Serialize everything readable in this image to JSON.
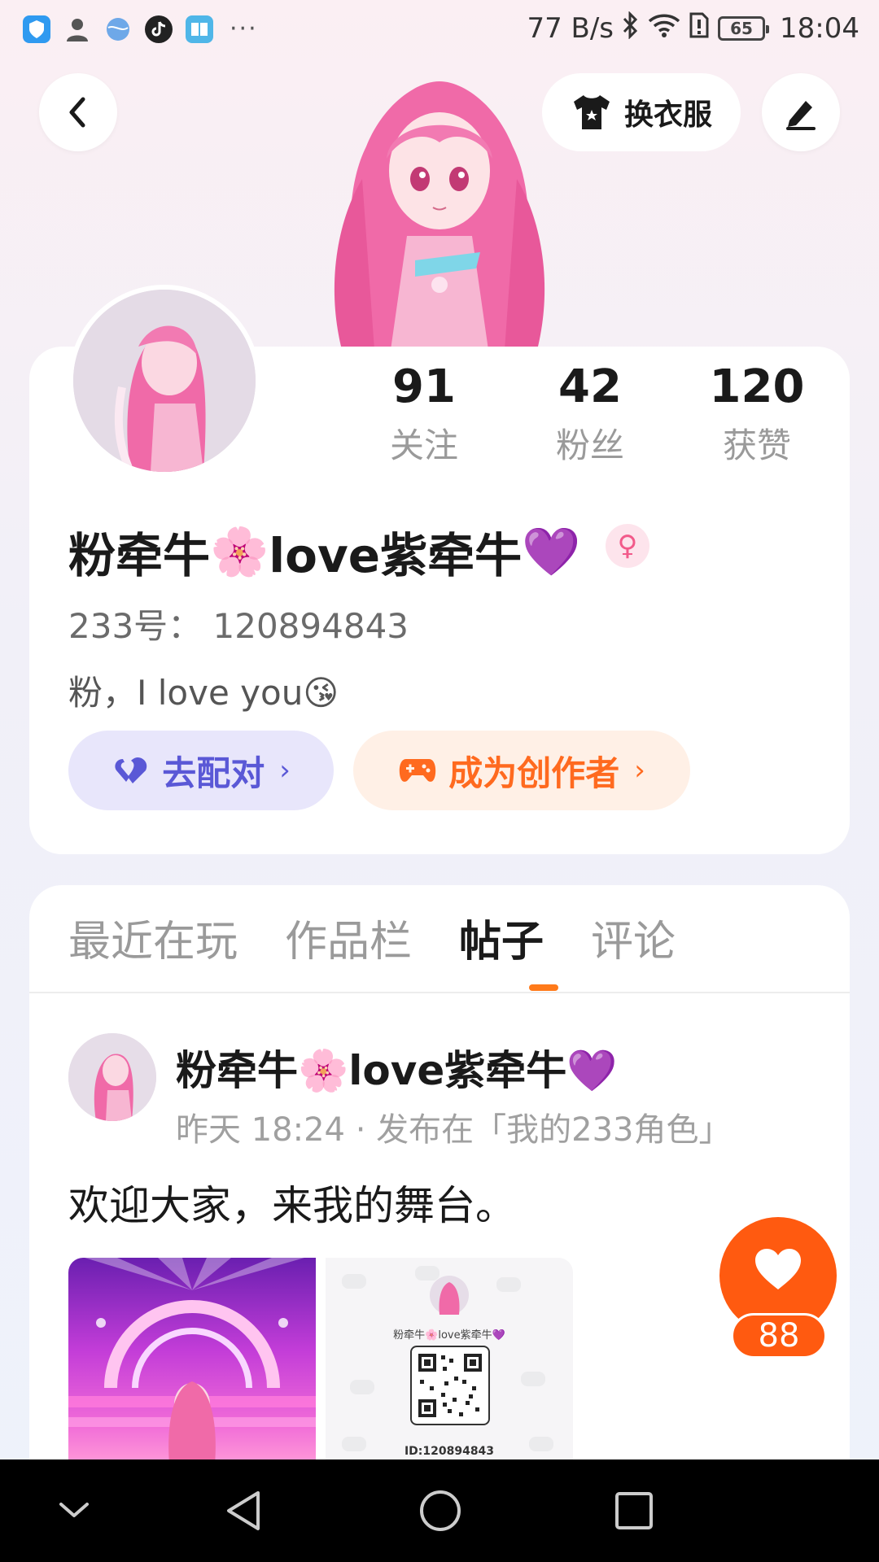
{
  "status_bar": {
    "apps": [
      "shield-app-icon",
      "person-app-icon",
      "globe-app-icon",
      "tiktok-app-icon",
      "book-app-icon"
    ],
    "more": "···",
    "net_speed": "77 B/s",
    "battery": "65",
    "time": "18:04"
  },
  "header": {
    "outfit_label": "换衣服"
  },
  "profile": {
    "stats": [
      {
        "value": "91",
        "label": "关注"
      },
      {
        "value": "42",
        "label": "粉丝"
      },
      {
        "value": "120",
        "label": "获赞"
      }
    ],
    "nickname_part1": "粉牵牛",
    "nickname_emoji1": "🌸",
    "nickname_part2": "love紫牵牛",
    "nickname_emoji2": "💜",
    "gender_symbol": "♀",
    "uid": "233号：  120894843",
    "bio": "粉，I love you😘",
    "match_label": "去配对",
    "creator_label": "成为创作者",
    "chevron": "›",
    "accent_purple": "#5a58d6",
    "accent_orange": "#ff6a1f"
  },
  "tabs": [
    {
      "label": "最近在玩",
      "active": false
    },
    {
      "label": "作品栏",
      "active": false
    },
    {
      "label": "帖子",
      "active": true
    },
    {
      "label": "评论",
      "active": false
    }
  ],
  "post": {
    "author": "粉牵牛🌸love紫牵牛💜",
    "meta": "昨天 18:24 · 发布在「我的233角色」",
    "text": "欢迎大家，来我的舞台。",
    "card_name": "粉牵牛🌸love紫牵牛💜",
    "card_id": "ID:120894843"
  },
  "like": {
    "count": "88"
  }
}
